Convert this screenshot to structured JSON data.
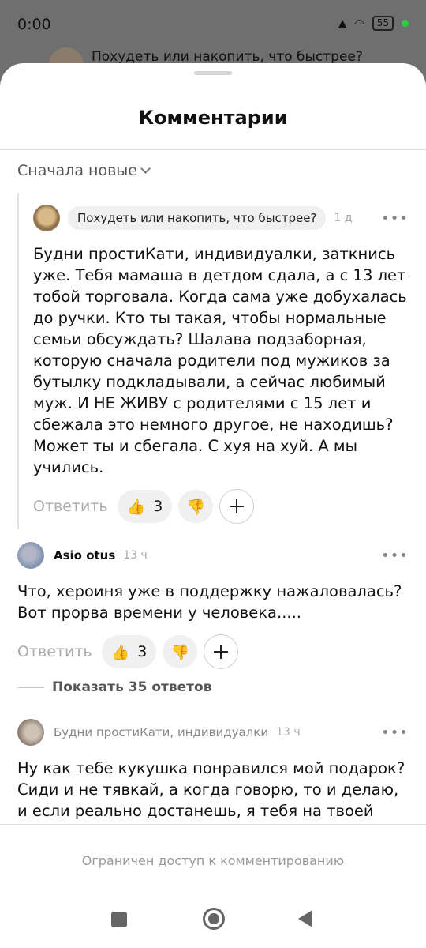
{
  "status": {
    "time": "0:00",
    "battery": "55"
  },
  "background": {
    "article_title": "Похудеть или накопить, что быстрее?"
  },
  "sheet": {
    "title": "Комментарии",
    "sort_label": "Сначала новые"
  },
  "comments": [
    {
      "badge": "Похудеть или накопить, что быстрее?",
      "time": "1 д",
      "text": "Будни простиКати, индивидуалки, заткнись уже.  Тебя мамаша в детдом сдала, а с 13 лет тобой торговала. Когда сама уже добухалась до ручки. Кто ты такая, чтобы нормальные семьи обсуждать? Шалава подзаборная, которую сначала родители под мужиков за бутылку подкладывали, а сейчас любимый муж. И НЕ ЖИВУ с родителями с 15 лет и сбежала это немного другое, не находишь? Может ты и сбегала. С хуя на хуй. А мы учились.",
      "reply_label": "Ответить",
      "likes": "3"
    },
    {
      "author": "Asio otus",
      "time": "13 ч",
      "text": "Что, хероиня уже в поддержку нажаловалась? Вот прорва времени у человека.....",
      "reply_label": "Ответить",
      "likes": "3"
    },
    {
      "author": "Будни простиКати, индивидуалки",
      "time": "13 ч",
      "text": "Ну как тебе кукушка понравился мой подарок? Сиди и не тявкай, а когда говорю, то и делаю, и если реально достанешь, я тебя на твоей"
    }
  ],
  "show_replies_label": "Показать 35 ответов",
  "footer": {
    "restricted_text": "Ограничен доступ к комментированию"
  },
  "icons": {
    "more": "•••",
    "like_emoji": "👍",
    "dislike_emoji": "👎"
  }
}
